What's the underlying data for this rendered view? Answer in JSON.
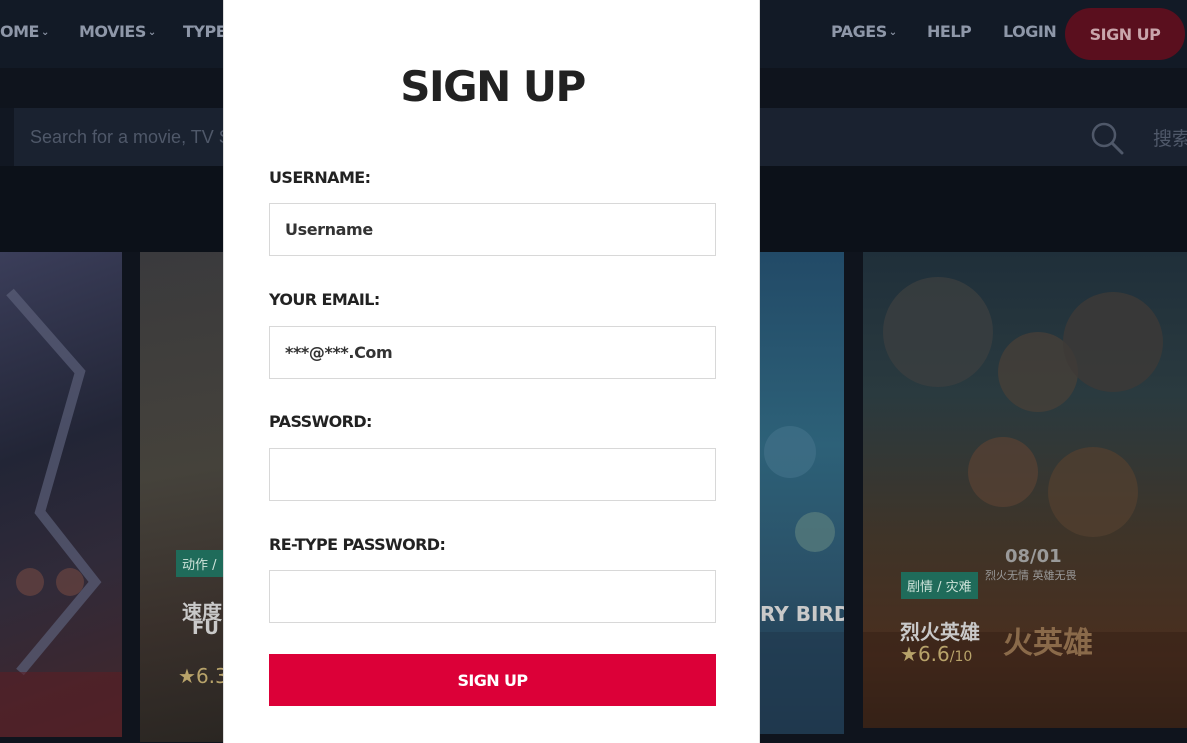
{
  "nav": {
    "home": "OME",
    "movies": "MOVIES",
    "type": "TYPE",
    "pages": "PAGES",
    "help": "HELP",
    "login": "LOGIN",
    "signup": "SIGN UP",
    "chevron": "⌄"
  },
  "search": {
    "placeholder": "Search for a movie, TV S",
    "button": "搜索"
  },
  "posters": {
    "p2_tag": "动作 /",
    "p2_title_cn": "速度",
    "p2_title_en": "FU",
    "p2_rating": "6.3",
    "p3_title": "RY BIRDS",
    "p4_tag": "剧情 / 灾难",
    "p4_title": "烈火英雄",
    "p4_rating": "6.6",
    "p4_rating_max": "/10",
    "p4_date": "08/01",
    "p4_slogan": "烈火无情 英雄无畏",
    "p4_art_title": "火英雄"
  },
  "modal": {
    "title": "SIGN UP",
    "username_label": "USERNAME:",
    "username_placeholder": "Username",
    "email_label": "YOUR EMAIL:",
    "email_value": "***@***.Com",
    "password_label": "PASSWORD:",
    "retype_label": "RE-TYPE PASSWORD:",
    "submit": "SIGN UP"
  },
  "colors": {
    "accent": "#dc0038",
    "background": "#0f141d"
  }
}
